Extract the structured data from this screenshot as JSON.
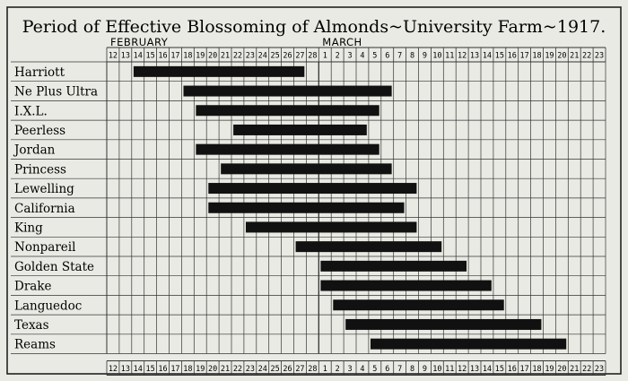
{
  "chart_data": {
    "type": "bar",
    "title": "Period of Effective Blossoming of Almonds~University Farm~1917.",
    "month_labels": [
      "FEBRUARY",
      "MARCH"
    ],
    "tick_labels": [
      "12",
      "13",
      "14",
      "15",
      "16",
      "17",
      "18",
      "19",
      "20",
      "21",
      "22",
      "23",
      "24",
      "25",
      "26",
      "27",
      "28",
      "1",
      "2",
      "3",
      "4",
      "5",
      "6",
      "7",
      "8",
      "9",
      "10",
      "11",
      "12",
      "13",
      "14",
      "15",
      "16",
      "17",
      "18",
      "19",
      "20",
      "21",
      "22",
      "23"
    ],
    "categories": [
      "Harriott",
      "Ne Plus Ultra",
      "I.X.L.",
      "Peerless",
      "Jordan",
      "Princess",
      "Lewelling",
      "California",
      "King",
      "Nonpareil",
      "Golden State",
      "Drake",
      "Languedoc",
      "Texas",
      "Reams"
    ],
    "bars": [
      {
        "start": "Feb 14",
        "end": "Feb 27"
      },
      {
        "start": "Feb 18",
        "end": "Mar 6"
      },
      {
        "start": "Feb 19",
        "end": "Mar 5"
      },
      {
        "start": "Feb 22",
        "end": "Mar 4"
      },
      {
        "start": "Feb 19",
        "end": "Mar 5"
      },
      {
        "start": "Feb 21",
        "end": "Mar 6"
      },
      {
        "start": "Feb 20",
        "end": "Mar 8"
      },
      {
        "start": "Feb 20",
        "end": "Mar 7"
      },
      {
        "start": "Feb 23",
        "end": "Mar 8"
      },
      {
        "start": "Feb 27",
        "end": "Mar 10"
      },
      {
        "start": "Mar 1",
        "end": "Mar 12"
      },
      {
        "start": "Mar 1",
        "end": "Mar 14"
      },
      {
        "start": "Mar 2",
        "end": "Mar 15"
      },
      {
        "start": "Mar 3",
        "end": "Mar 18"
      },
      {
        "start": "Mar 5",
        "end": "Mar 20"
      }
    ],
    "grid": true,
    "colors": {
      "bar": "#111111",
      "grid": "#333333",
      "background": "#eaeae4"
    }
  }
}
